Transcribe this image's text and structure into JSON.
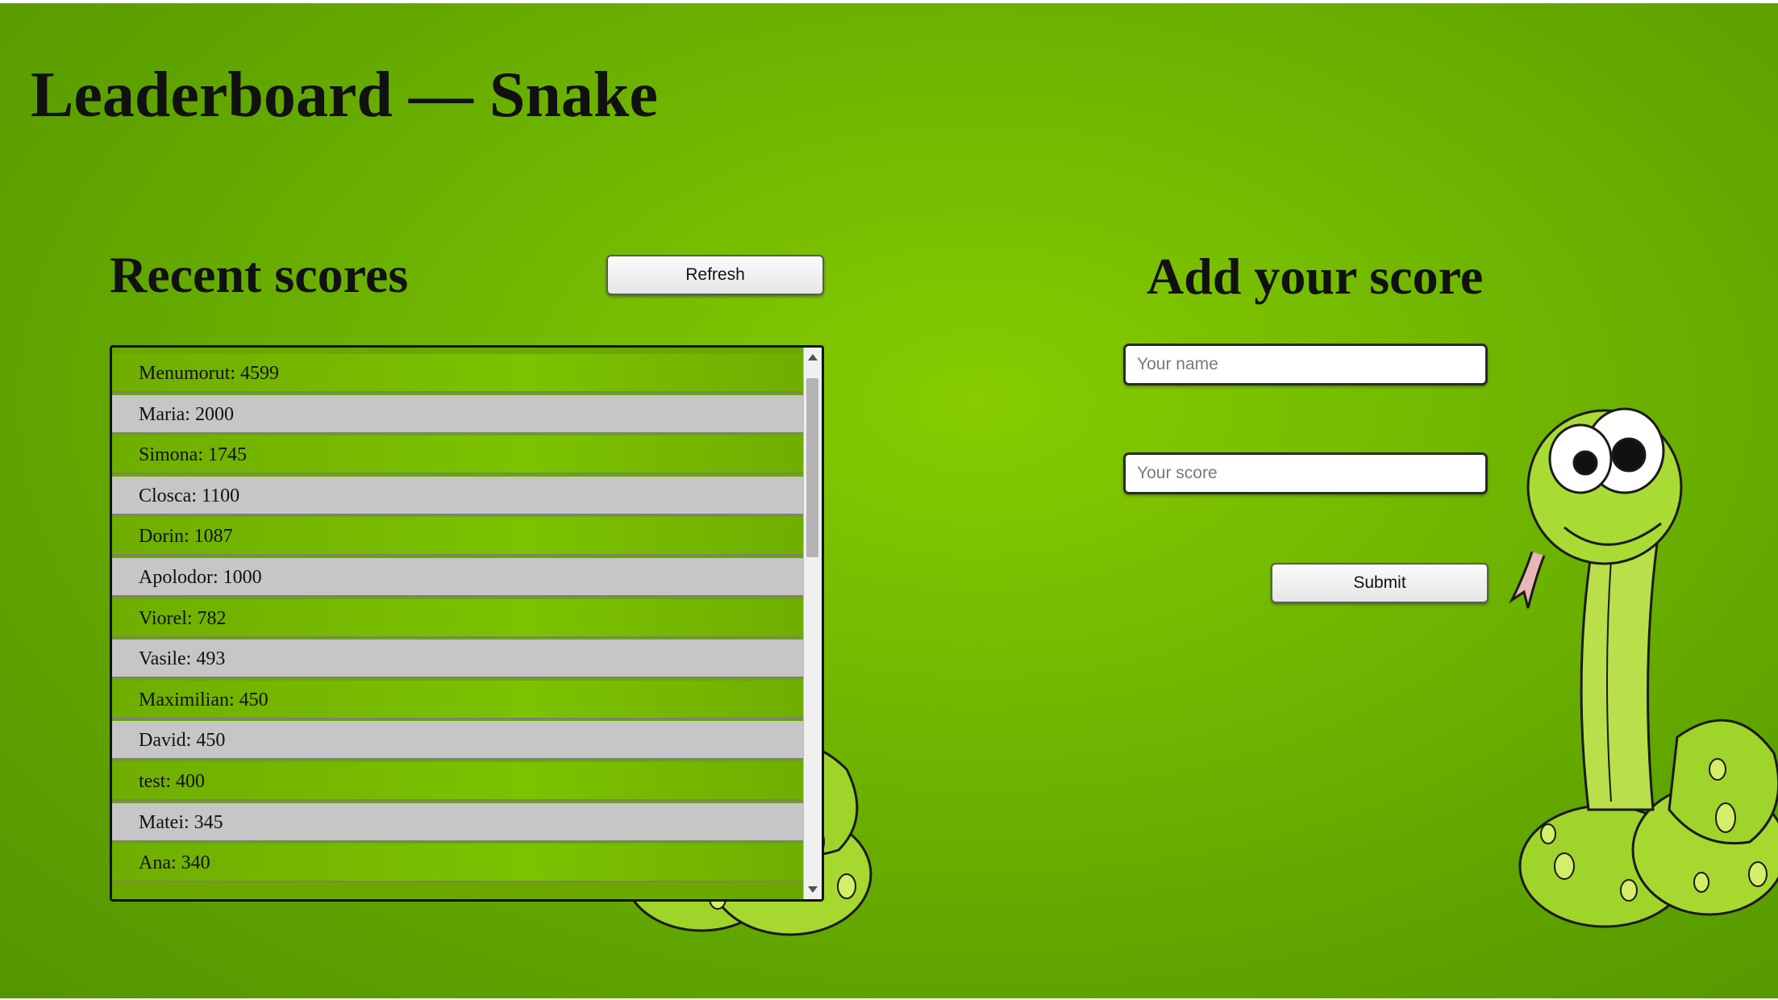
{
  "page": {
    "title": "Leaderboard — Snake"
  },
  "recent": {
    "heading": "Recent scores",
    "refresh_label": "Refresh",
    "scores": [
      "Menumorut: 4599",
      "Maria: 2000",
      "Simona: 1745",
      "Closca: 1100",
      "Dorin: 1087",
      "Apolodor: 1000",
      "Viorel: 782",
      "Vasile: 493",
      "Maximilian: 450",
      "David: 450",
      "test: 400",
      "Matei: 345",
      "Ana: 340"
    ]
  },
  "add": {
    "heading": "Add your score",
    "name_placeholder": "Your name",
    "score_placeholder": "Your score",
    "submit_label": "Submit"
  },
  "colors": {
    "background": "#72b800",
    "row_green": "#7cc200",
    "row_gray": "#c6c6c6"
  },
  "icons": {
    "decoration": "cartoon-snake-image"
  }
}
